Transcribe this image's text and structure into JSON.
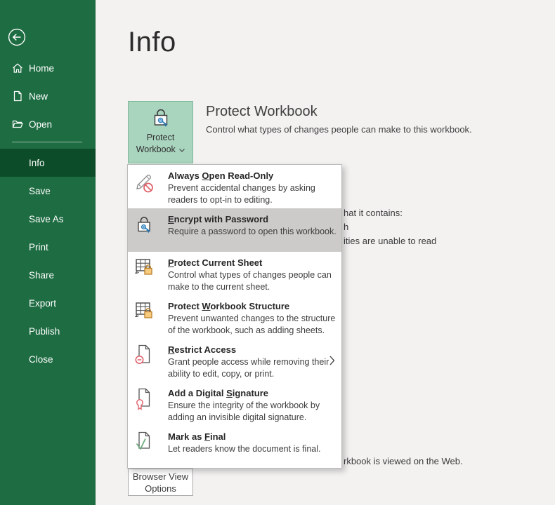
{
  "colors": {
    "sidebar_green": "#1E6C42",
    "sidebar_active_green": "#0C4C28",
    "protect_button_bg": "#A9D4BE",
    "protect_button_border": "#7FB99C",
    "menu_highlight_gray": "#CCCBC9",
    "background_gray": "#F3F2F1",
    "accent_red": "#DF5E68",
    "accent_blue": "#2B7CB9",
    "accent_orange": "#E9A13B",
    "accent_green": "#6CA97A"
  },
  "sidebar": {
    "back_icon": "back-arrow-icon",
    "top_items": [
      {
        "label": "Home",
        "icon": "home-icon"
      },
      {
        "label": "New",
        "icon": "new-document-icon"
      },
      {
        "label": "Open",
        "icon": "open-folder-icon"
      }
    ],
    "items": [
      "Info",
      "Save",
      "Save As",
      "Print",
      "Share",
      "Export",
      "Publish",
      "Close"
    ],
    "active_item": "Info"
  },
  "page": {
    "title": "Info"
  },
  "protect_section": {
    "button_line1": "Protect",
    "button_line2": "Workbook",
    "button_icon": "lock-key-icon",
    "heading": "Protect Workbook",
    "description": "Control what types of changes people can make to this workbook."
  },
  "menu": {
    "items": [
      {
        "icon": "read-only-pencil-icon",
        "title_pre": "Always ",
        "title_key": "O",
        "title_post": "pen Read-Only",
        "desc1": "Prevent accidental changes by asking",
        "desc2": "readers to opt-in to editing.",
        "highlighted": false
      },
      {
        "icon": "encrypt-lock-key-icon",
        "title_pre": "",
        "title_key": "E",
        "title_post": "ncrypt with Password",
        "desc1": "Require a password to open this workbook.",
        "desc2": "",
        "highlighted": true
      },
      {
        "icon": "protect-sheet-lock-icon",
        "title_pre": "",
        "title_key": "P",
        "title_post": "rotect Current Sheet",
        "desc1": "Control what types of changes people can",
        "desc2": "make to the current sheet.",
        "highlighted": false
      },
      {
        "icon": "protect-structure-lock-icon",
        "title_pre": "Protect ",
        "title_key": "W",
        "title_post": "orkbook Structure",
        "desc1": "Prevent unwanted changes to the structure",
        "desc2": "of the workbook, such as adding sheets.",
        "highlighted": false
      },
      {
        "icon": "restrict-access-document-icon",
        "title_pre": "",
        "title_key": "R",
        "title_post": "estrict Access",
        "desc1": "Grant people access while removing their",
        "desc2": "ability to edit, copy, or print.",
        "highlighted": false,
        "has_submenu": true
      },
      {
        "icon": "digital-signature-document-icon",
        "title_pre": "Add a Digital ",
        "title_key": "S",
        "title_post": "ignature",
        "desc1": "Ensure the integrity of the workbook by",
        "desc2": "adding an invisible digital signature.",
        "highlighted": false
      },
      {
        "icon": "mark-final-document-icon",
        "title_pre": "Mark as ",
        "title_key": "F",
        "title_post": "inal",
        "desc1": "Let readers know the document is final.",
        "desc2": "",
        "highlighted": false
      }
    ]
  },
  "background_fragments": {
    "line1": "hat it contains:",
    "line2": "h",
    "line3": "ities are unable to read",
    "line4": "rkbook is viewed on the Web."
  },
  "browser_view_options": {
    "line1": "Browser View",
    "line2": "Options"
  }
}
